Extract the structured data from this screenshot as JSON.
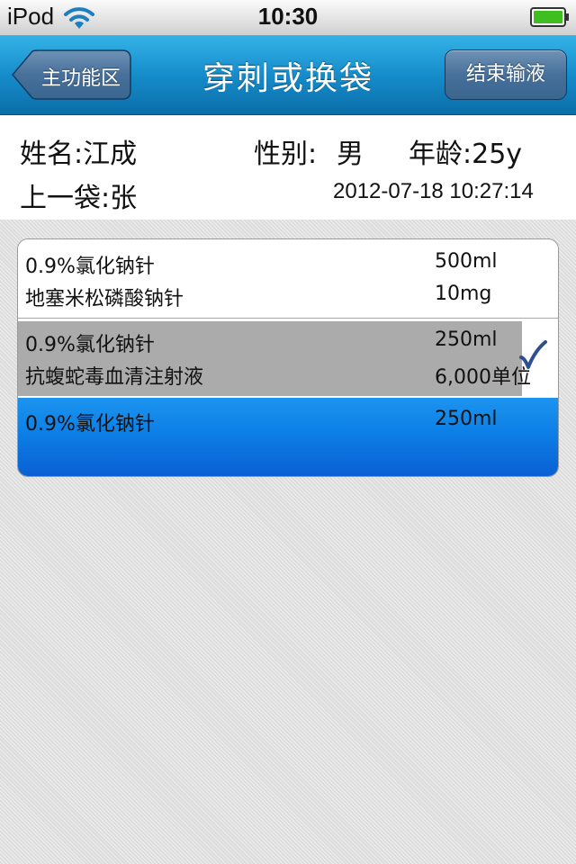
{
  "status_bar": {
    "carrier": "iPod",
    "time": "10:30",
    "wifi_icon": "wifi-icon",
    "battery_icon": "battery-icon",
    "battery_color": "#3fbf1f"
  },
  "nav": {
    "title": "穿刺或换袋",
    "back_label": "主功能区",
    "end_label": "结束输液",
    "bar_color": "#168ccb"
  },
  "patient": {
    "name_label": "姓名:江成",
    "gender_label": "性别:",
    "gender_value": "男",
    "age_label": "年龄:25y",
    "last_bag_label": "上一袋:张",
    "datetime": "2012-07-18 10:27:14"
  },
  "bags": [
    {
      "state": "normal",
      "items": [
        {
          "name": "0.9%氯化钠针",
          "dose": "500ml"
        },
        {
          "name": "地塞米松磷酸钠针",
          "dose": "10mg"
        }
      ]
    },
    {
      "state": "checked",
      "check_icon": "checkmark-icon",
      "items": [
        {
          "name": "0.9%氯化钠针",
          "dose": "250ml"
        },
        {
          "name": "抗蝮蛇毒血清注射液",
          "dose": "6,000单位"
        }
      ]
    },
    {
      "state": "selected",
      "selected_color": "#0c7fe6",
      "items": [
        {
          "name": "0.9%氯化钠针",
          "dose": "250ml"
        }
      ]
    }
  ]
}
